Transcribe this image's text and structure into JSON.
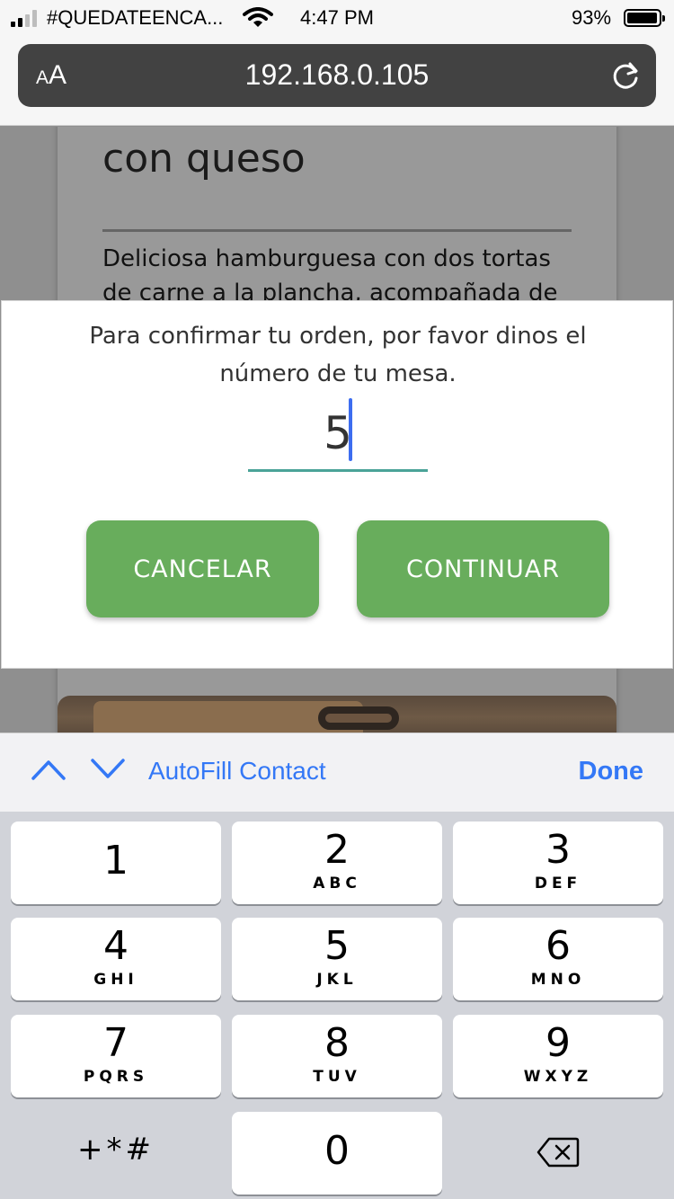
{
  "status_bar": {
    "carrier": "#QUEDATEENCA...",
    "time": "4:47 PM",
    "battery_percent": "93%",
    "battery_level": 0.93,
    "signal_bars": 2
  },
  "browser": {
    "text_size_label_small": "A",
    "text_size_label_large": "A",
    "url": "192.168.0.105"
  },
  "page": {
    "card_title": "con queso",
    "card_description": "Deliciosa hamburguesa con dos tortas de carne a la plancha, acompañada de"
  },
  "dialog": {
    "message": "Para confirmar tu orden, por favor dinos el número de tu mesa.",
    "input_value": "5",
    "cancel_label": "CANCELAR",
    "continue_label": "CONTINUAR"
  },
  "accessory": {
    "autofill_label": "AutoFill Contact",
    "done_label": "Done"
  },
  "keypad": {
    "keys": [
      {
        "num": "1",
        "letters": ""
      },
      {
        "num": "2",
        "letters": "ABC"
      },
      {
        "num": "3",
        "letters": "DEF"
      },
      {
        "num": "4",
        "letters": "GHI"
      },
      {
        "num": "5",
        "letters": "JKL"
      },
      {
        "num": "6",
        "letters": "MNO"
      },
      {
        "num": "7",
        "letters": "PQRS"
      },
      {
        "num": "8",
        "letters": "TUV"
      },
      {
        "num": "9",
        "letters": "WXYZ"
      },
      {
        "num": "0",
        "letters": ""
      }
    ],
    "symbols_label": "+*#"
  },
  "colors": {
    "accent_blue": "#3478f6",
    "button_green": "#68ad5c",
    "field_underline": "#4aa398"
  }
}
